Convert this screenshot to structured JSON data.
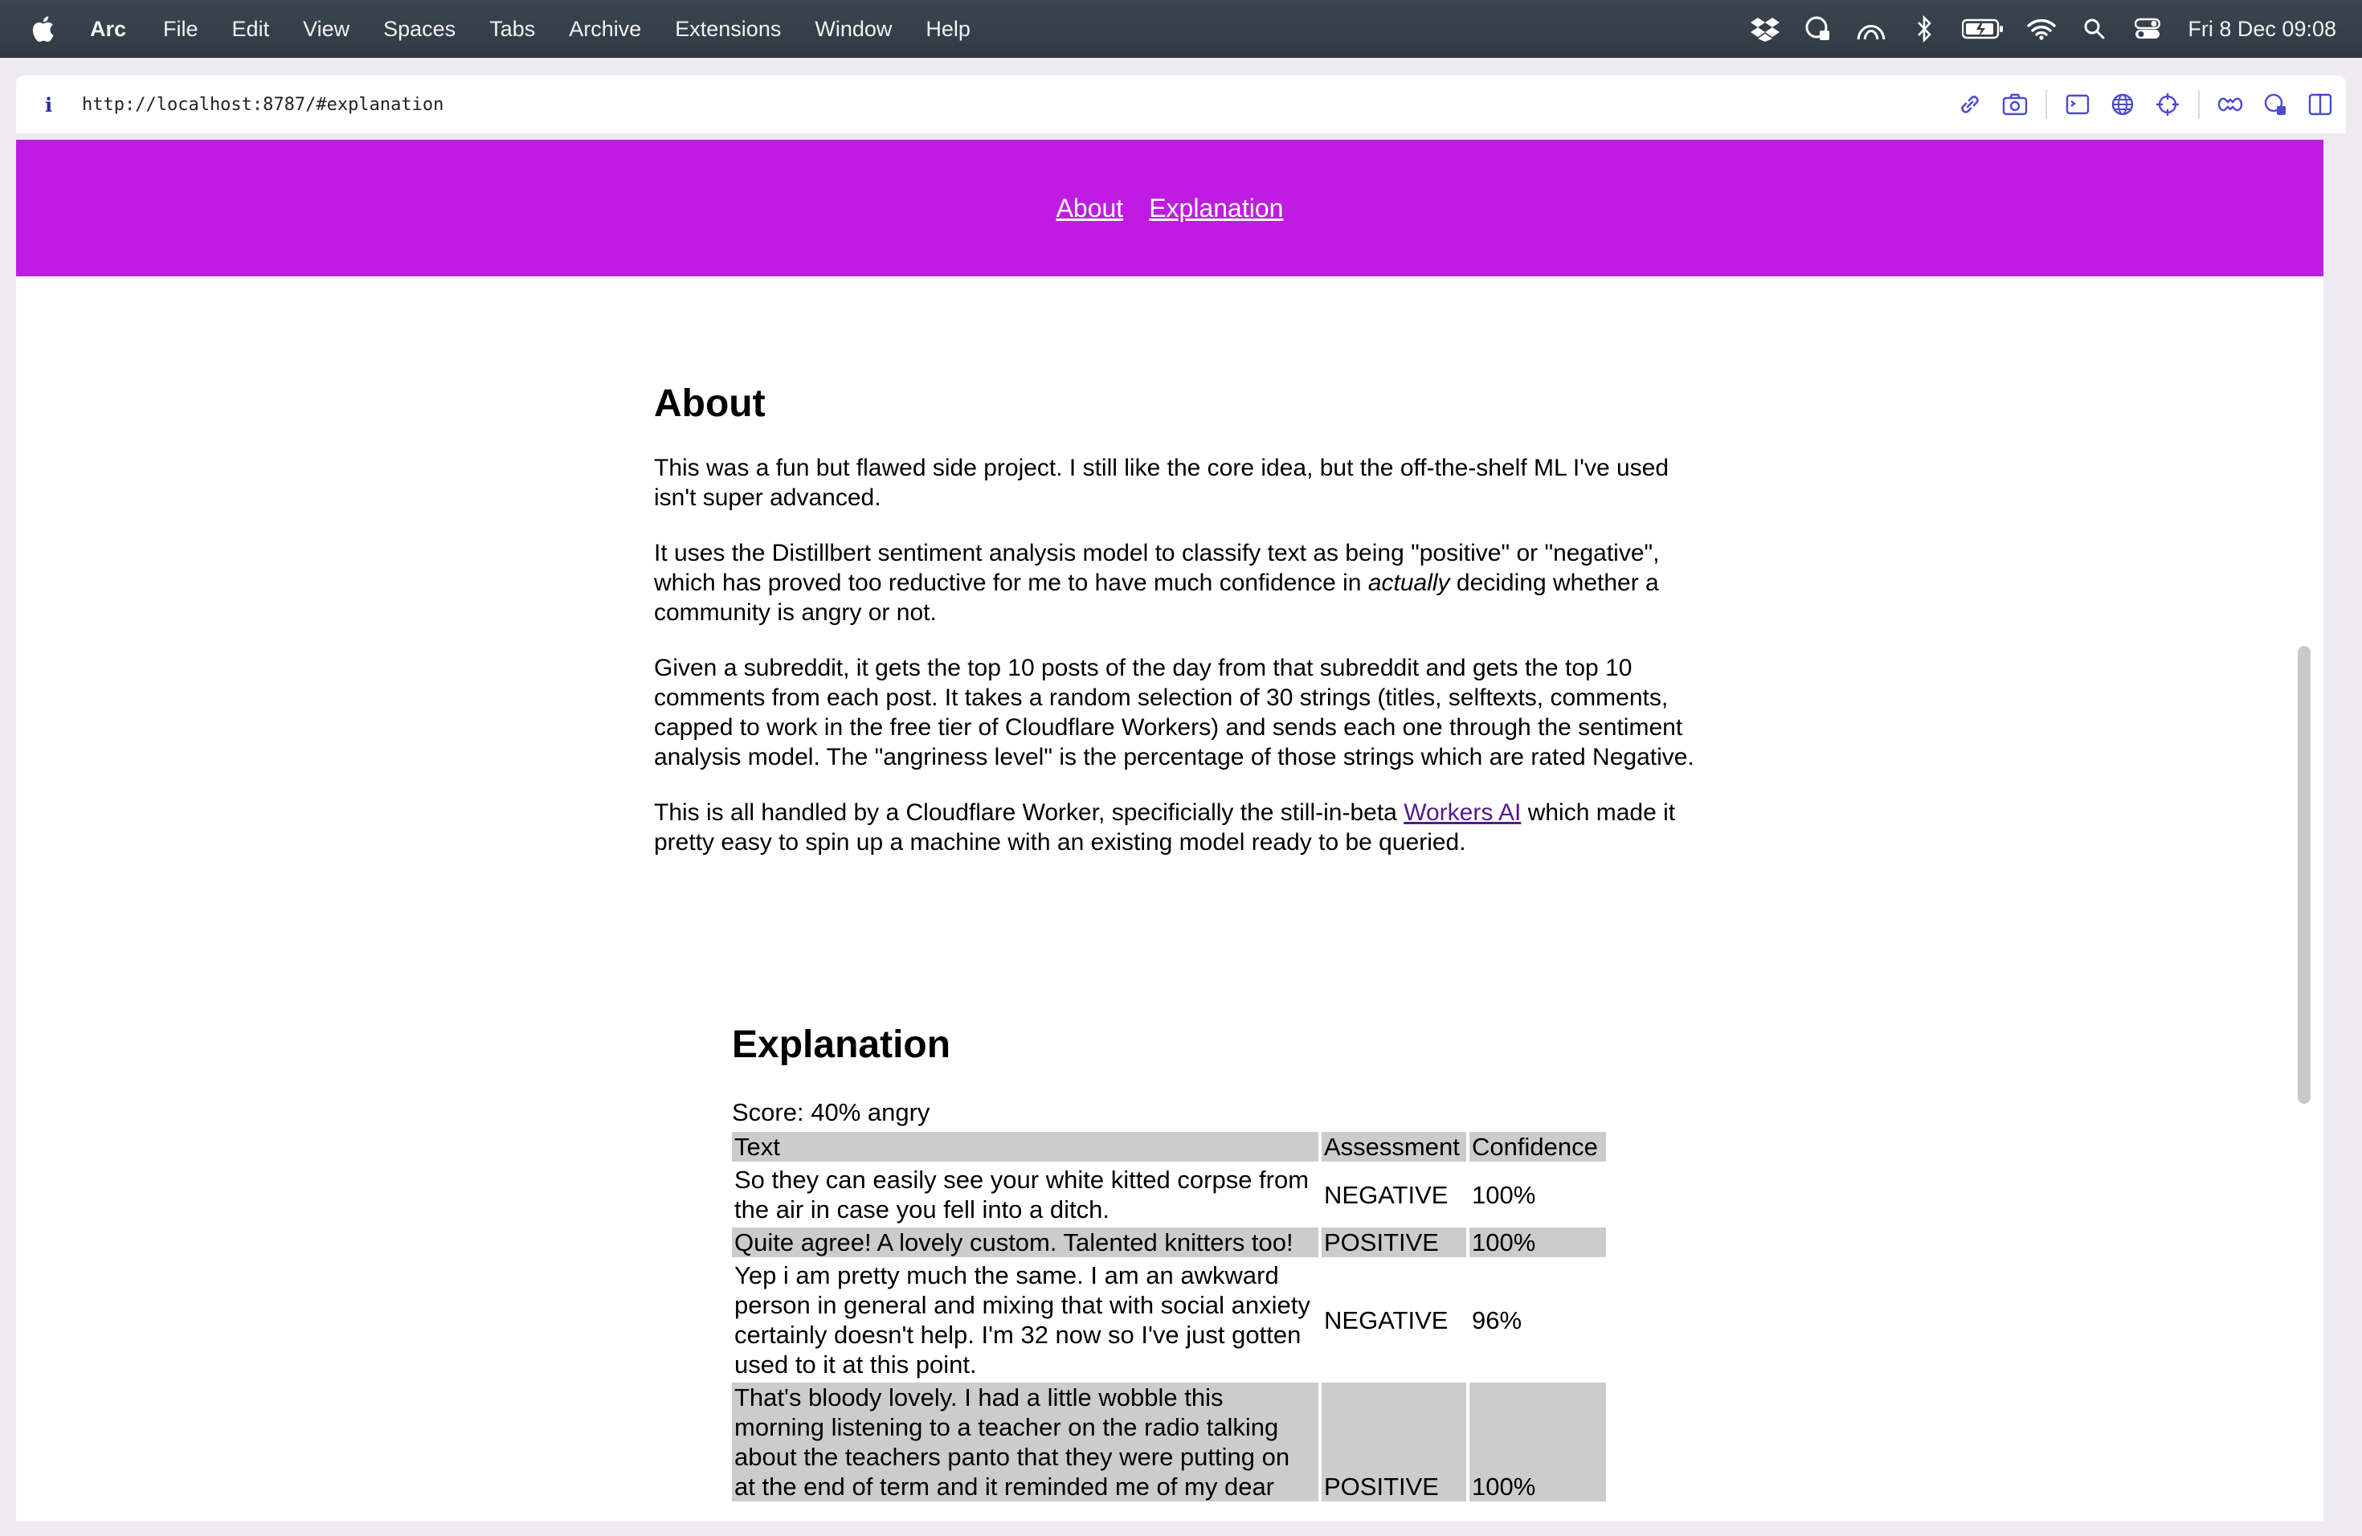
{
  "menubar": {
    "app": "Arc",
    "items": [
      "File",
      "Edit",
      "View",
      "Spaces",
      "Tabs",
      "Archive",
      "Extensions",
      "Window",
      "Help"
    ],
    "clock": "Fri 8 Dec  09:08"
  },
  "browser": {
    "url": "http://localhost:8787/#explanation",
    "info_glyph": "i"
  },
  "header": {
    "links": [
      "About",
      "Explanation"
    ],
    "bg": "#c01be3"
  },
  "about": {
    "title": "About",
    "p1": "This was a fun but flawed side project. I still like the core idea, but the off-the-shelf ML I've used isn't super advanced.",
    "p2_before": "It uses the Distillbert sentiment analysis model to classify text as being \"positive\" or \"negative\", which has proved too reductive for me to have much confidence in ",
    "p2_em": "actually",
    "p2_after": " deciding whether a community is angry or not.",
    "p3": "Given a subreddit, it gets the top 10 posts of the day from that subreddit and gets the top 10 comments from each post. It takes a random selection of 30 strings (titles, selftexts, comments, capped to work in the free tier of Cloudflare Workers) and sends each one through the sentiment analysis model. The \"angriness level\" is the percentage of those strings which are rated Negative.",
    "p4_before": "This is all handled by a Cloudflare Worker, specificially the still-in-beta ",
    "p4_link": "Workers AI",
    "p4_after": " which made it pretty easy to spin up a machine with an existing model ready to be queried."
  },
  "explanation": {
    "title": "Explanation",
    "score": "Score: 40% angry",
    "columns": [
      "Text",
      "Assessment",
      "Confidence"
    ],
    "rows": [
      {
        "text": "So they can easily see your white kitted corpse from the air in case you fell into a ditch.",
        "assessment": "NEGATIVE",
        "confidence": "100%"
      },
      {
        "text": "Quite agree! A lovely custom. Talented knitters too!",
        "assessment": "POSITIVE",
        "confidence": "100%"
      },
      {
        "text": "Yep i am pretty much the same. I am an awkward person in general and mixing that with social anxiety certainly doesn't help. I'm 32 now so I've just gotten used to it at this point.",
        "assessment": "NEGATIVE",
        "confidence": "96%"
      },
      {
        "text": "That's bloody lovely. I had a little wobble this morning listening to a teacher on the radio talking about the teachers panto that they were putting on at the end of term and it reminded me of my dear",
        "assessment": "POSITIVE",
        "confidence": "100%"
      }
    ]
  }
}
